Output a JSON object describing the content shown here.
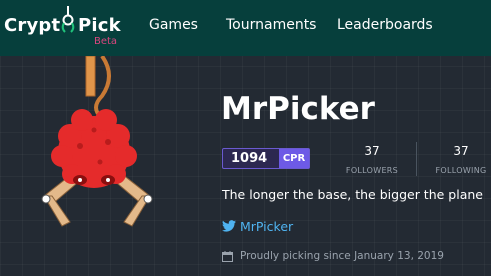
{
  "brand": {
    "name_part1": "Crypt",
    "name_part2": "Pick",
    "badge": "Beta",
    "accent_color": "#d9467e"
  },
  "nav": {
    "items": [
      {
        "label": "Games"
      },
      {
        "label": "Tournaments"
      },
      {
        "label": "Leaderboards"
      }
    ]
  },
  "profile": {
    "username": "MrPicker",
    "rating": {
      "value": "1094",
      "label": "CPR"
    },
    "followers": {
      "count": "37",
      "label": "FOLLOWERS"
    },
    "following": {
      "count": "37",
      "label": "FOLLOWING"
    },
    "bio": "The longer the base, the bigger the plane",
    "twitter": {
      "handle": "MrPicker",
      "icon": "twitter-bird-icon"
    },
    "member_since": {
      "text": "Proudly picking since January 13, 2019",
      "icon": "calendar-icon"
    },
    "avatar": {
      "icon": "claw-mascot-icon",
      "color": "#e52b2b"
    }
  },
  "colors": {
    "navbar": "#063f3c",
    "background": "#232a33",
    "rating_accent": "#6d5ae6",
    "link": "#4fb3f0"
  }
}
